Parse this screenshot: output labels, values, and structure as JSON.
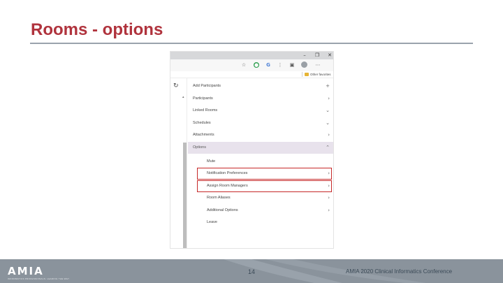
{
  "slide": {
    "title": "Rooms - options",
    "page_number": "14",
    "conference": "AMIA 2020 Clinical Informatics Conference",
    "logo_text": "AMIA",
    "logo_tagline": "INFORMATICS PROFESSIONALS. LEADING THE WAY.",
    "title_color": "#b0333d",
    "footer_color": "#8a939c"
  },
  "browser": {
    "window_controls": [
      "–",
      "❐",
      "✕"
    ],
    "bookmark_folder": "Other favorites",
    "reload_icon": "reload-icon"
  },
  "menu": {
    "items": [
      {
        "label": "Add Participants",
        "chevron": "+"
      },
      {
        "label": "Participants",
        "chevron": "›"
      },
      {
        "label": "Linked Rooms",
        "chevron": "⌄"
      },
      {
        "label": "Schedules",
        "chevron": "⌄"
      },
      {
        "label": "Attachments",
        "chevron": "›"
      },
      {
        "label": "Options",
        "chevron": "⌃"
      }
    ],
    "sub_items": [
      {
        "label": "Mute",
        "chevron": ""
      },
      {
        "label": "Notification Preferences",
        "chevron": "›"
      },
      {
        "label": "Assign Room Managers",
        "chevron": "›"
      },
      {
        "label": "Room Aliases",
        "chevron": "›"
      },
      {
        "label": "Additional Options",
        "chevron": "›"
      },
      {
        "label": "Leave",
        "chevron": ""
      }
    ],
    "highlight_color": "#c62828"
  }
}
